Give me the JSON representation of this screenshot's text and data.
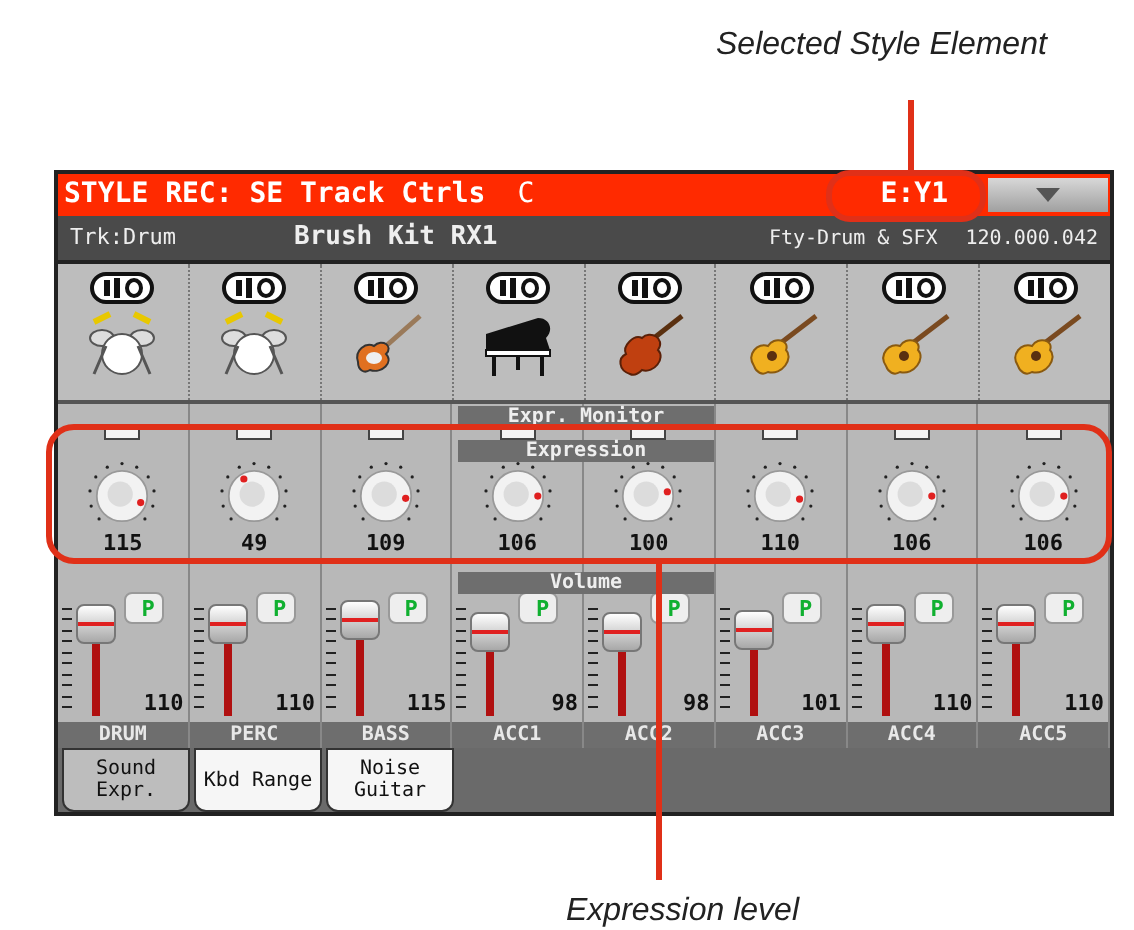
{
  "callouts": [
    {
      "kind": "top",
      "text": "Selected Style Element"
    },
    {
      "kind": "bottom",
      "text": "Expression level"
    }
  ],
  "title_bar": {
    "title": "STYLE REC: SE Track Ctrls",
    "key": "C",
    "element": "E:Y1"
  },
  "info_bar": {
    "track": "Trk:Drum",
    "sound": "Brush Kit RX1",
    "bank": "Fty-Drum & SFX",
    "program": "120.000.042"
  },
  "section_labels": {
    "monitor": "Expr. Monitor",
    "expression": "Expression",
    "volume": "Volume"
  },
  "channels": [
    {
      "kind": "drums",
      "expression": "115",
      "volume": "110",
      "play": "P",
      "name": "DRUM"
    },
    {
      "kind": "drums",
      "expression": "49",
      "volume": "110",
      "play": "P",
      "name": "PERC"
    },
    {
      "kind": "electric-guitar",
      "expression": "109",
      "volume": "115",
      "play": "P",
      "name": "BASS"
    },
    {
      "kind": "piano",
      "expression": "106",
      "volume": "98",
      "play": "P",
      "name": "ACC1"
    },
    {
      "kind": "violin",
      "expression": "100",
      "volume": "98",
      "play": "P",
      "name": "ACC2"
    },
    {
      "kind": "acoustic-guitar",
      "expression": "110",
      "volume": "101",
      "play": "P",
      "name": "ACC3"
    },
    {
      "kind": "acoustic-guitar",
      "expression": "106",
      "volume": "110",
      "play": "P",
      "name": "ACC4"
    },
    {
      "kind": "acoustic-guitar",
      "expression": "106",
      "volume": "110",
      "play": "P",
      "name": "ACC5"
    }
  ],
  "tabs": [
    {
      "label": "Sound Expr.",
      "selected": true
    },
    {
      "label": "Kbd Range",
      "selected": false
    },
    {
      "label": "Noise Guitar",
      "selected": false
    }
  ]
}
